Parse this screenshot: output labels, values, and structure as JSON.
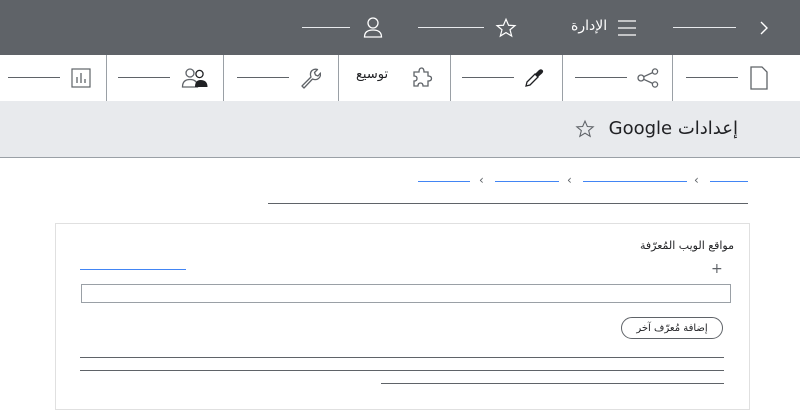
{
  "header": {
    "admin_label": "الإدارة"
  },
  "toolbar": {
    "extensions_label": "توسيع"
  },
  "page": {
    "title": "إعدادات Google"
  },
  "card": {
    "heading": "مواقع الويب المُعرّفة",
    "add_button_label": "إضافة مُعرّف آخر",
    "url_input_value": "",
    "add_icon": "+"
  },
  "breadcrumb": {
    "separator": "›"
  }
}
